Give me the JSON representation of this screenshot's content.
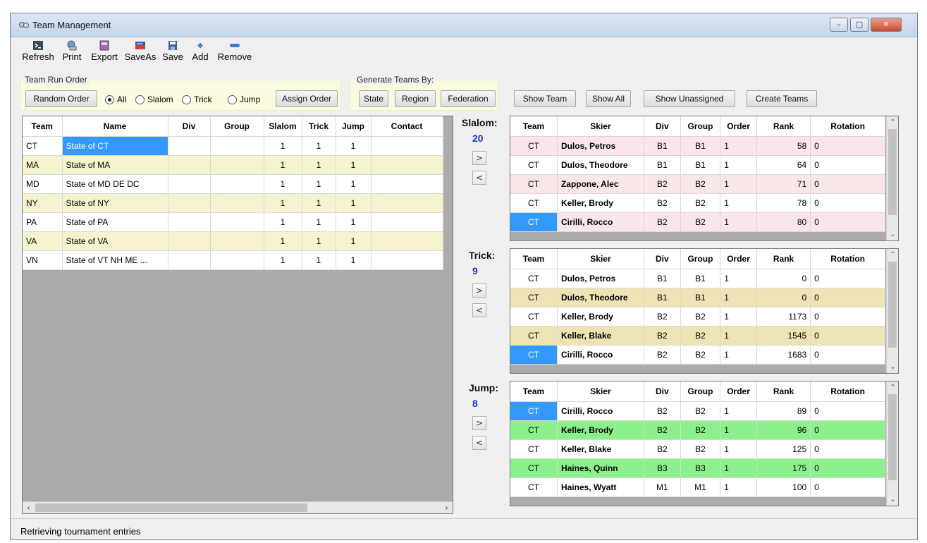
{
  "window": {
    "title": "Team Management",
    "minimize": "–",
    "maximize": "□",
    "close": "✕"
  },
  "toolbar": [
    {
      "label": "Refresh",
      "icon": "refresh-icon"
    },
    {
      "label": "Print",
      "icon": "print-icon"
    },
    {
      "label": "Export",
      "icon": "export-icon"
    },
    {
      "label": "SaveAs",
      "icon": "saveas-icon"
    },
    {
      "label": "Save",
      "icon": "save-icon"
    },
    {
      "label": "Add",
      "icon": "add-icon"
    },
    {
      "label": "Remove",
      "icon": "remove-icon"
    }
  ],
  "run_order": {
    "group_label": "Team Run Order",
    "random_button": "Random Order",
    "radios": [
      {
        "label": "All",
        "checked": true
      },
      {
        "label": "Slalom",
        "checked": false
      },
      {
        "label": "Trick",
        "checked": false
      },
      {
        "label": "Jump",
        "checked": false
      }
    ],
    "assign_button": "Assign Order"
  },
  "generate": {
    "group_label": "Generate Teams By:",
    "buttons": [
      "State",
      "Region",
      "Federation"
    ]
  },
  "actions": [
    "Show Team",
    "Show All",
    "Show Unassigned",
    "Create Teams"
  ],
  "teams_table": {
    "columns": [
      "Team",
      "Name",
      "Div",
      "Group",
      "Slalom",
      "Trick",
      "Jump",
      "Contact"
    ],
    "rows": [
      {
        "team": "CT",
        "name": "State of CT",
        "div": "",
        "group": "",
        "slalom": "1",
        "trick": "1",
        "jump": "1",
        "contact": ""
      },
      {
        "team": "MA",
        "name": "State of MA",
        "div": "",
        "group": "",
        "slalom": "1",
        "trick": "1",
        "jump": "1",
        "contact": ""
      },
      {
        "team": "MD",
        "name": "State of MD DE DC",
        "div": "",
        "group": "",
        "slalom": "1",
        "trick": "1",
        "jump": "1",
        "contact": ""
      },
      {
        "team": "NY",
        "name": "State of NY",
        "div": "",
        "group": "",
        "slalom": "1",
        "trick": "1",
        "jump": "1",
        "contact": ""
      },
      {
        "team": "PA",
        "name": "State of PA",
        "div": "",
        "group": "",
        "slalom": "1",
        "trick": "1",
        "jump": "1",
        "contact": ""
      },
      {
        "team": "VA",
        "name": "State of VA",
        "div": "",
        "group": "",
        "slalom": "1",
        "trick": "1",
        "jump": "1",
        "contact": ""
      },
      {
        "team": "VN",
        "name": "State of VT NH ME ...",
        "div": "",
        "group": "",
        "slalom": "1",
        "trick": "1",
        "jump": "1",
        "contact": ""
      }
    ]
  },
  "events": [
    {
      "label": "Slalom:",
      "count": "20",
      "right_btn": ">",
      "left_btn": "<",
      "alt_color": "#fbe6e9",
      "columns": [
        "Team",
        "Skier",
        "Div",
        "Group",
        "Order",
        "Rank",
        "Rotation"
      ],
      "rows": [
        {
          "team": "CT",
          "skier": "Dulos, Petros",
          "div": "B1",
          "group": "B1",
          "order": "1",
          "rank": "58",
          "rotation": "0"
        },
        {
          "team": "CT",
          "skier": "Dulos, Theodore",
          "div": "B1",
          "group": "B1",
          "order": "1",
          "rank": "64",
          "rotation": "0"
        },
        {
          "team": "CT",
          "skier": "Zappone, Alec",
          "div": "B2",
          "group": "B2",
          "order": "1",
          "rank": "71",
          "rotation": "0"
        },
        {
          "team": "CT",
          "skier": "Keller, Brody",
          "div": "B2",
          "group": "B2",
          "order": "1",
          "rank": "78",
          "rotation": "0"
        },
        {
          "team": "CT",
          "skier": "Cirilli, Rocco",
          "div": "B2",
          "group": "B2",
          "order": "1",
          "rank": "80",
          "rotation": "0"
        }
      ]
    },
    {
      "label": "Trick:",
      "count": "9",
      "right_btn": ">",
      "left_btn": "<",
      "alt_color": "#ede3b4",
      "columns": [
        "Team",
        "Skier",
        "Div",
        "Group",
        "Order",
        "Rank",
        "Rotation"
      ],
      "rows": [
        {
          "team": "CT",
          "skier": "Dulos, Petros",
          "div": "B1",
          "group": "B1",
          "order": "1",
          "rank": "0",
          "rotation": "0"
        },
        {
          "team": "CT",
          "skier": "Dulos, Theodore",
          "div": "B1",
          "group": "B1",
          "order": "1",
          "rank": "0",
          "rotation": "0"
        },
        {
          "team": "CT",
          "skier": "Keller, Brody",
          "div": "B2",
          "group": "B2",
          "order": "1",
          "rank": "1173",
          "rotation": "0"
        },
        {
          "team": "CT",
          "skier": "Keller, Blake",
          "div": "B2",
          "group": "B2",
          "order": "1",
          "rank": "1545",
          "rotation": "0"
        },
        {
          "team": "CT",
          "skier": "Cirilli, Rocco",
          "div": "B2",
          "group": "B2",
          "order": "1",
          "rank": "1683",
          "rotation": "0"
        }
      ]
    },
    {
      "label": "Jump:",
      "count": "8",
      "right_btn": ">",
      "left_btn": "<",
      "alt_color": "#8cf18c",
      "columns": [
        "Team",
        "Skier",
        "Div",
        "Group",
        "Order",
        "Rank",
        "Rotation"
      ],
      "rows": [
        {
          "team": "CT",
          "skier": "Cirilli, Rocco",
          "div": "B2",
          "group": "B2",
          "order": "1",
          "rank": "89",
          "rotation": "0"
        },
        {
          "team": "CT",
          "skier": "Keller, Brody",
          "div": "B2",
          "group": "B2",
          "order": "1",
          "rank": "96",
          "rotation": "0"
        },
        {
          "team": "CT",
          "skier": "Keller, Blake",
          "div": "B2",
          "group": "B2",
          "order": "1",
          "rank": "125",
          "rotation": "0"
        },
        {
          "team": "CT",
          "skier": "Haines, Quinn",
          "div": "B3",
          "group": "B3",
          "order": "1",
          "rank": "175",
          "rotation": "0"
        },
        {
          "team": "CT",
          "skier": "Haines, Wyatt",
          "div": "M1",
          "group": "M1",
          "order": "1",
          "rank": "100",
          "rotation": "0"
        }
      ]
    }
  ],
  "status": "Retrieving tournament entries"
}
